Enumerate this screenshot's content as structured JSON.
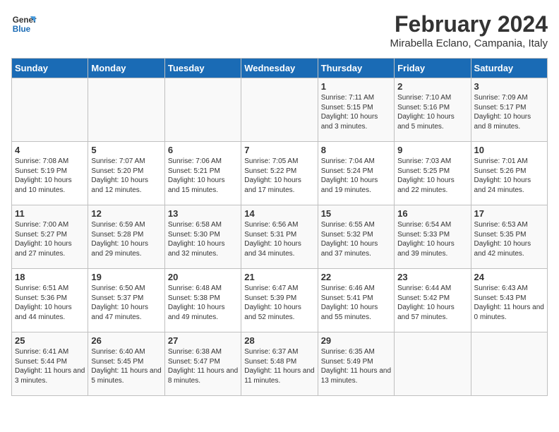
{
  "header": {
    "logo_general": "General",
    "logo_blue": "Blue",
    "title": "February 2024",
    "subtitle": "Mirabella Eclano, Campania, Italy"
  },
  "days_of_week": [
    "Sunday",
    "Monday",
    "Tuesday",
    "Wednesday",
    "Thursday",
    "Friday",
    "Saturday"
  ],
  "weeks": [
    [
      {
        "day": "",
        "content": ""
      },
      {
        "day": "",
        "content": ""
      },
      {
        "day": "",
        "content": ""
      },
      {
        "day": "",
        "content": ""
      },
      {
        "day": "1",
        "content": "Sunrise: 7:11 AM\nSunset: 5:15 PM\nDaylight: 10 hours\nand 3 minutes."
      },
      {
        "day": "2",
        "content": "Sunrise: 7:10 AM\nSunset: 5:16 PM\nDaylight: 10 hours\nand 5 minutes."
      },
      {
        "day": "3",
        "content": "Sunrise: 7:09 AM\nSunset: 5:17 PM\nDaylight: 10 hours\nand 8 minutes."
      }
    ],
    [
      {
        "day": "4",
        "content": "Sunrise: 7:08 AM\nSunset: 5:19 PM\nDaylight: 10 hours\nand 10 minutes."
      },
      {
        "day": "5",
        "content": "Sunrise: 7:07 AM\nSunset: 5:20 PM\nDaylight: 10 hours\nand 12 minutes."
      },
      {
        "day": "6",
        "content": "Sunrise: 7:06 AM\nSunset: 5:21 PM\nDaylight: 10 hours\nand 15 minutes."
      },
      {
        "day": "7",
        "content": "Sunrise: 7:05 AM\nSunset: 5:22 PM\nDaylight: 10 hours\nand 17 minutes."
      },
      {
        "day": "8",
        "content": "Sunrise: 7:04 AM\nSunset: 5:24 PM\nDaylight: 10 hours\nand 19 minutes."
      },
      {
        "day": "9",
        "content": "Sunrise: 7:03 AM\nSunset: 5:25 PM\nDaylight: 10 hours\nand 22 minutes."
      },
      {
        "day": "10",
        "content": "Sunrise: 7:01 AM\nSunset: 5:26 PM\nDaylight: 10 hours\nand 24 minutes."
      }
    ],
    [
      {
        "day": "11",
        "content": "Sunrise: 7:00 AM\nSunset: 5:27 PM\nDaylight: 10 hours\nand 27 minutes."
      },
      {
        "day": "12",
        "content": "Sunrise: 6:59 AM\nSunset: 5:28 PM\nDaylight: 10 hours\nand 29 minutes."
      },
      {
        "day": "13",
        "content": "Sunrise: 6:58 AM\nSunset: 5:30 PM\nDaylight: 10 hours\nand 32 minutes."
      },
      {
        "day": "14",
        "content": "Sunrise: 6:56 AM\nSunset: 5:31 PM\nDaylight: 10 hours\nand 34 minutes."
      },
      {
        "day": "15",
        "content": "Sunrise: 6:55 AM\nSunset: 5:32 PM\nDaylight: 10 hours\nand 37 minutes."
      },
      {
        "day": "16",
        "content": "Sunrise: 6:54 AM\nSunset: 5:33 PM\nDaylight: 10 hours\nand 39 minutes."
      },
      {
        "day": "17",
        "content": "Sunrise: 6:53 AM\nSunset: 5:35 PM\nDaylight: 10 hours\nand 42 minutes."
      }
    ],
    [
      {
        "day": "18",
        "content": "Sunrise: 6:51 AM\nSunset: 5:36 PM\nDaylight: 10 hours\nand 44 minutes."
      },
      {
        "day": "19",
        "content": "Sunrise: 6:50 AM\nSunset: 5:37 PM\nDaylight: 10 hours\nand 47 minutes."
      },
      {
        "day": "20",
        "content": "Sunrise: 6:48 AM\nSunset: 5:38 PM\nDaylight: 10 hours\nand 49 minutes."
      },
      {
        "day": "21",
        "content": "Sunrise: 6:47 AM\nSunset: 5:39 PM\nDaylight: 10 hours\nand 52 minutes."
      },
      {
        "day": "22",
        "content": "Sunrise: 6:46 AM\nSunset: 5:41 PM\nDaylight: 10 hours\nand 55 minutes."
      },
      {
        "day": "23",
        "content": "Sunrise: 6:44 AM\nSunset: 5:42 PM\nDaylight: 10 hours\nand 57 minutes."
      },
      {
        "day": "24",
        "content": "Sunrise: 6:43 AM\nSunset: 5:43 PM\nDaylight: 11 hours\nand 0 minutes."
      }
    ],
    [
      {
        "day": "25",
        "content": "Sunrise: 6:41 AM\nSunset: 5:44 PM\nDaylight: 11 hours\nand 3 minutes."
      },
      {
        "day": "26",
        "content": "Sunrise: 6:40 AM\nSunset: 5:45 PM\nDaylight: 11 hours\nand 5 minutes."
      },
      {
        "day": "27",
        "content": "Sunrise: 6:38 AM\nSunset: 5:47 PM\nDaylight: 11 hours\nand 8 minutes."
      },
      {
        "day": "28",
        "content": "Sunrise: 6:37 AM\nSunset: 5:48 PM\nDaylight: 11 hours\nand 11 minutes."
      },
      {
        "day": "29",
        "content": "Sunrise: 6:35 AM\nSunset: 5:49 PM\nDaylight: 11 hours\nand 13 minutes."
      },
      {
        "day": "",
        "content": ""
      },
      {
        "day": "",
        "content": ""
      }
    ]
  ]
}
